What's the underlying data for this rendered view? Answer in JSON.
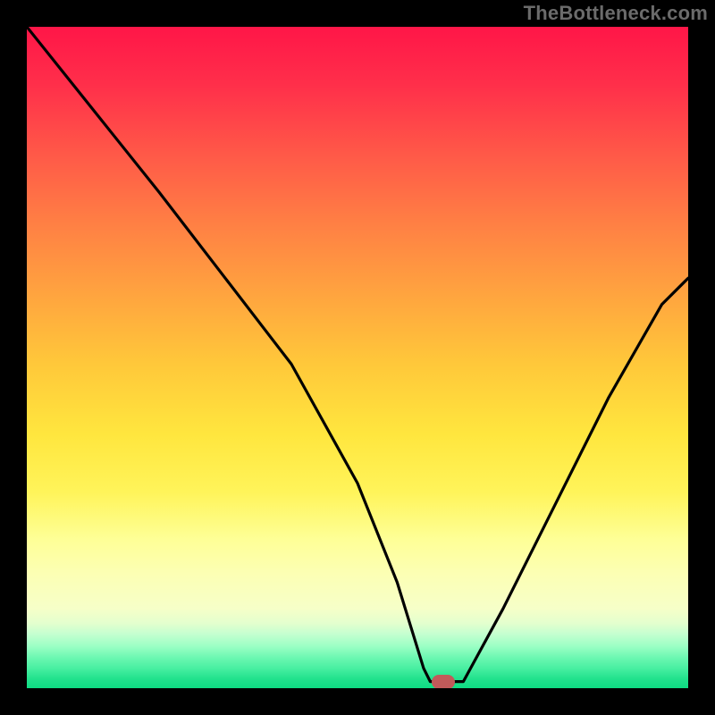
{
  "watermark": "TheBottleneck.com",
  "chart_data": {
    "type": "line",
    "title": "",
    "xlabel": "",
    "ylabel": "",
    "xlim": [
      0,
      100
    ],
    "ylim": [
      0,
      100
    ],
    "series": [
      {
        "name": "bottleneck-curve",
        "x": [
          0,
          8,
          20,
          30,
          40,
          50,
          56,
          60,
          61,
          64,
          66,
          72,
          80,
          88,
          96,
          100
        ],
        "values": [
          100,
          90,
          75,
          62,
          49,
          31,
          16,
          3,
          1,
          1,
          1,
          12,
          28,
          44,
          58,
          62
        ]
      }
    ],
    "marker": {
      "x": 63,
      "y": 1
    },
    "gradient_colors": {
      "top": "#ff1648",
      "bottom": "#0edc83"
    }
  }
}
